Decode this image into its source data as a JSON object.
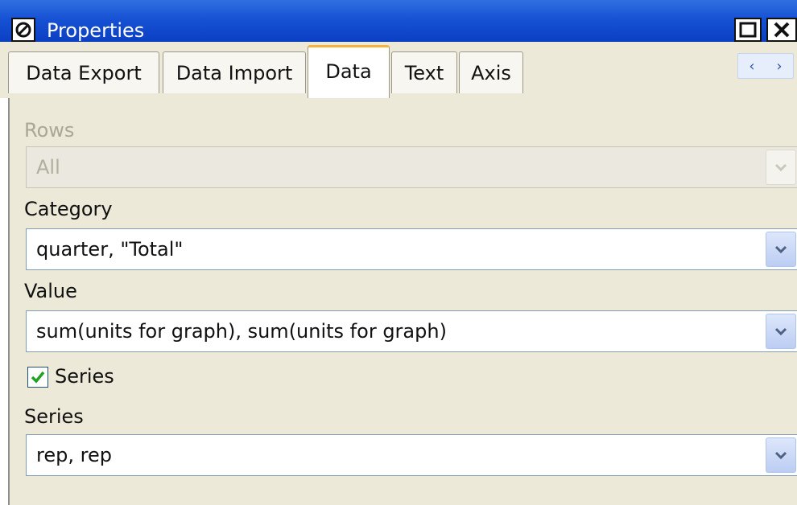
{
  "window": {
    "title": "Properties",
    "icon": "properties-icon",
    "controls": {
      "maximize_icon": "maximize-icon",
      "close_icon": "close-icon"
    }
  },
  "tabs": [
    {
      "label": "Data Export",
      "active": false
    },
    {
      "label": "Data Import",
      "active": false
    },
    {
      "label": "Data",
      "active": true
    },
    {
      "label": "Text",
      "active": false
    },
    {
      "label": "Axis",
      "active": false
    }
  ],
  "tab_scroll": {
    "left_icon": "chevron-left-icon",
    "right_icon": "chevron-right-icon",
    "left_glyph": "‹",
    "right_glyph": "›"
  },
  "form": {
    "rows": {
      "label": "Rows",
      "value": "All",
      "disabled": true
    },
    "category": {
      "label": "Category",
      "value": "quarter, \"Total\""
    },
    "value": {
      "label": "Value",
      "value": "sum(units for graph), sum(units for graph)"
    },
    "series_checkbox": {
      "label": "Series",
      "checked": true
    },
    "series": {
      "label": "Series",
      "value": "rep, rep"
    }
  },
  "colors": {
    "titlebar": "#1752d4",
    "panel": "#ece9d8",
    "active_tab_accent": "#f4b43a",
    "check_mark": "#21a121"
  }
}
